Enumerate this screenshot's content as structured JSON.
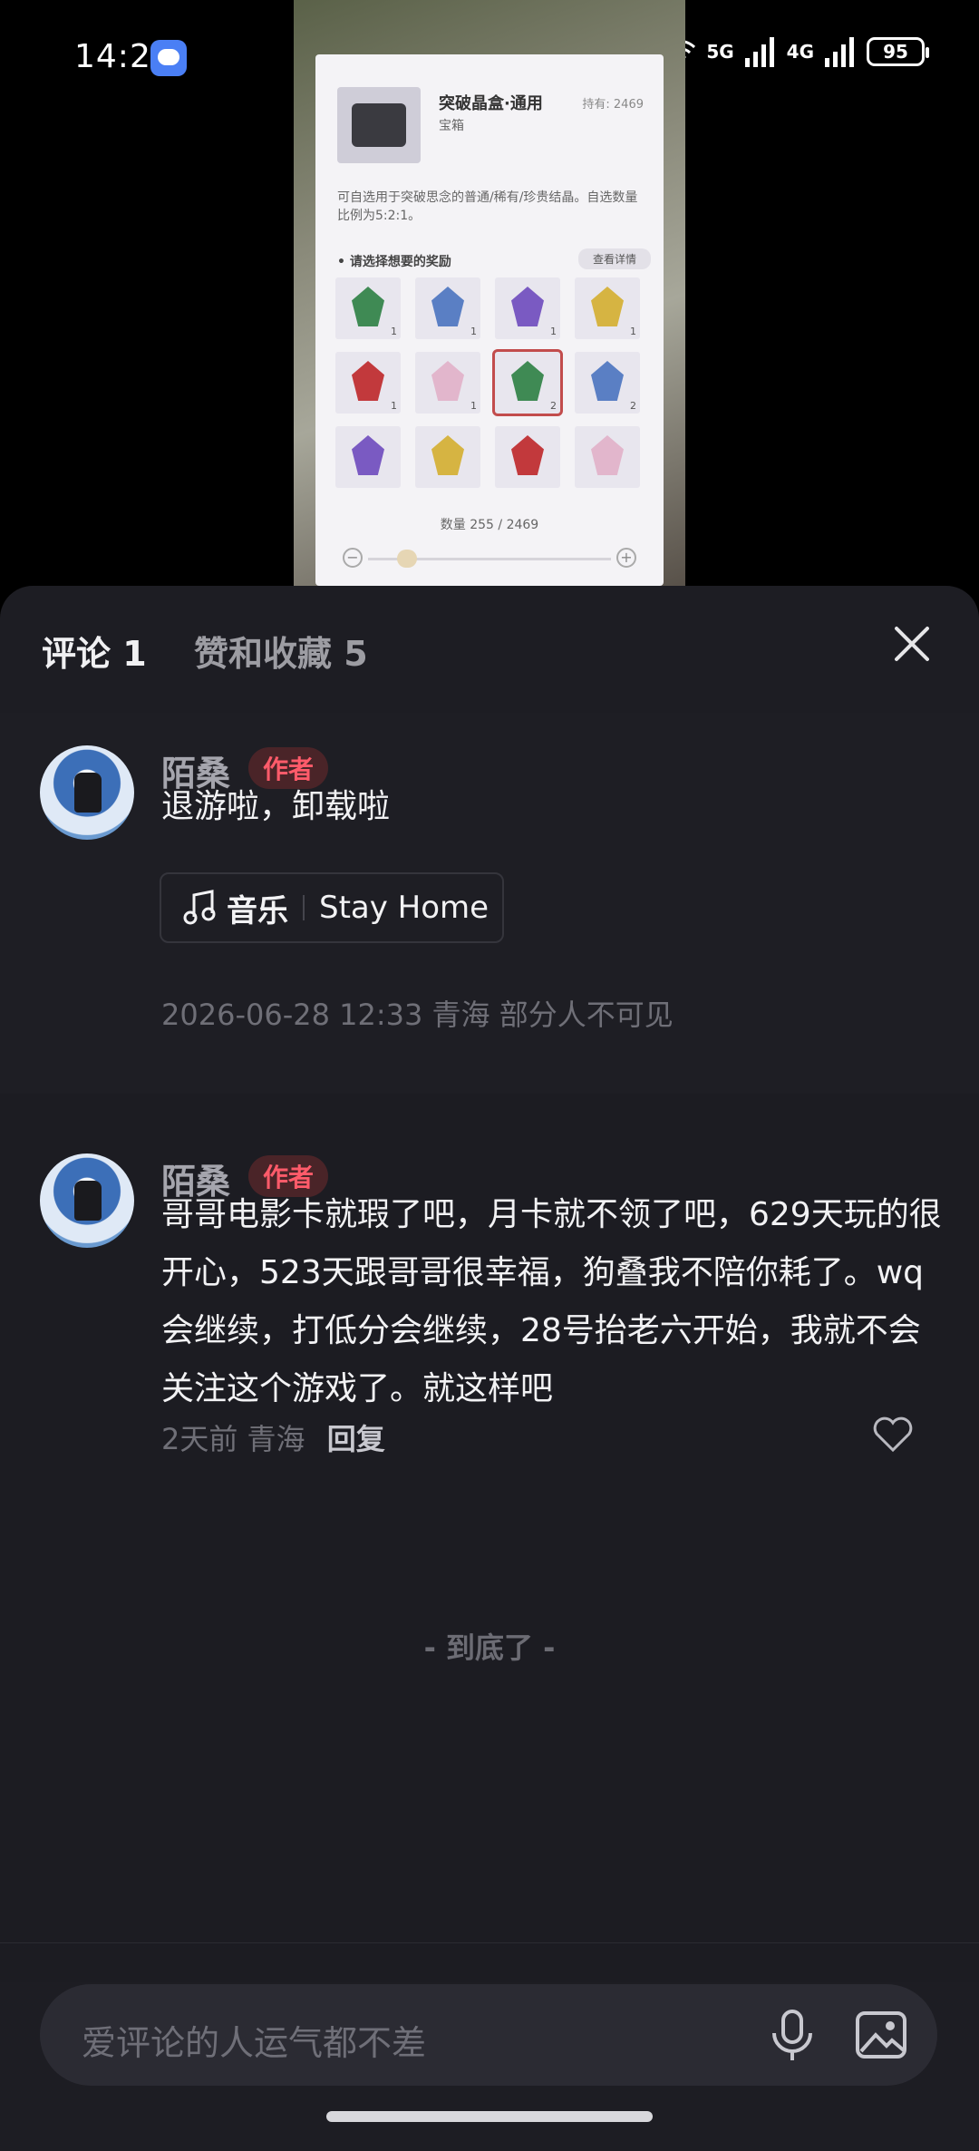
{
  "status": {
    "time": "14:21",
    "battery": "95",
    "net1": "5G",
    "net2": "4G"
  },
  "preview": {
    "title": "突破晶盒·通用",
    "subtitle": "宝箱",
    "hold": "持有: 2469",
    "desc": "可自选用于突破思念的普通/稀有/珍贵结晶。自选数量比例为5:2:1。",
    "prompt": "• 请选择想要的奖励",
    "detail": "查看详情",
    "qty": "数量  255  /  2469",
    "gems": [
      {
        "color": "#3f8a54",
        "count": "1"
      },
      {
        "color": "#5a7fc4",
        "count": "1"
      },
      {
        "color": "#7a5ac2",
        "count": "1"
      },
      {
        "color": "#d6b442",
        "count": "1"
      },
      {
        "color": "#c2393c",
        "count": "1"
      },
      {
        "color": "#e2b6cc",
        "count": "1"
      },
      {
        "color": "#3f8a54",
        "count": "2",
        "selected": true
      },
      {
        "color": "#5a7fc4",
        "count": "2"
      },
      {
        "color": "#7a5ac2",
        "count": ""
      },
      {
        "color": "#d6b442",
        "count": ""
      },
      {
        "color": "#c2393c",
        "count": ""
      },
      {
        "color": "#e2b6cc",
        "count": ""
      }
    ]
  },
  "tabs": {
    "comments": "评论 1",
    "likes": "赞和收藏 5"
  },
  "comment1": {
    "name": "陌桑",
    "badge": "作者",
    "text": "退游啦，卸载啦",
    "music_label": "音乐",
    "music_title": "Stay Home",
    "meta": "2026-06-28 12:33  青海   部分人不可见"
  },
  "comment2": {
    "name": "陌桑",
    "badge": "作者",
    "text": "哥哥电影卡就瑕了吧，月卡就不领了吧，629天玩的很开心，523天跟哥哥很幸福，狗叠我不陪你耗了。wq会继续，打低分会继续，28号抬老六开始，我就不会关注这个游戏了。就这样吧",
    "meta": "2天前 青海",
    "reply": "回复"
  },
  "end_text": "- 到底了 -",
  "input": {
    "placeholder": "爱评论的人运气都不差"
  }
}
